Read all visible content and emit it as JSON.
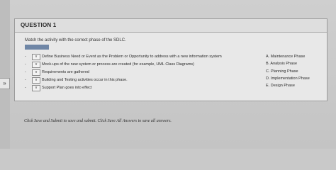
{
  "question": {
    "title": "QUESTION 1",
    "instruction": "Match the activity with the correct phase of the SDLC.",
    "grading_badge": "",
    "items": [
      {
        "dash": "-",
        "selector": "v",
        "statement": "Define Business Need or Event as the Problem or Opportunity to address with a new information system"
      },
      {
        "dash": "-",
        "selector": "v",
        "statement": "Mock-ups of the new system or process are created (for example, UML Class Diagrams)"
      },
      {
        "dash": "-",
        "selector": "v",
        "statement": "Requirements are gathered"
      },
      {
        "dash": "-",
        "selector": "v",
        "statement": "Building and Testing activities occur in this phase."
      },
      {
        "dash": "-",
        "selector": "v",
        "statement": "Support Plan goes into effect"
      }
    ],
    "options": [
      "A. Maintenance Phase",
      "B. Analysis Phase",
      "C. Planning Phase",
      "D. Implementation Phase",
      "E. Design Phase"
    ]
  },
  "footer": {
    "note": "Click Save and Submit to save and submit. Click Save All Answers to save all answers."
  },
  "side_tab": {
    "glyph": "»"
  },
  "colors": {
    "page_bg": "#c9c9c9",
    "panel_bg": "#e8e8e8",
    "badge_bg": "#6f86a6"
  }
}
